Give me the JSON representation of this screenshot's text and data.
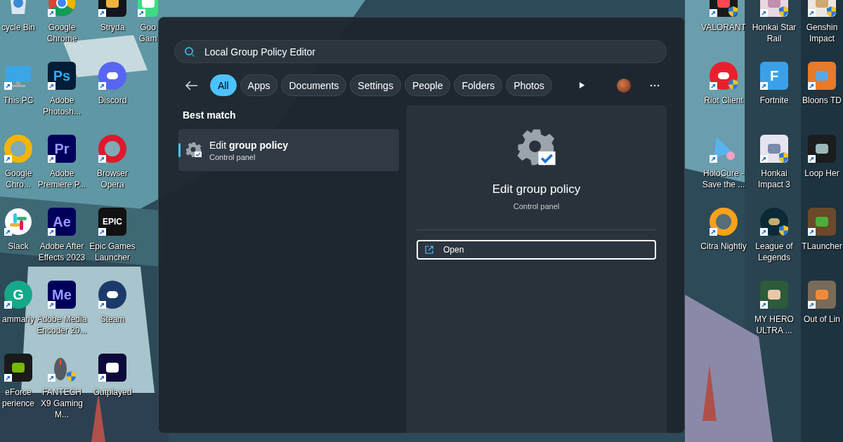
{
  "desktop": {
    "left_columns": [
      [
        {
          "label": "cycle Bin",
          "kind": "bin",
          "shortcut": false,
          "shield": false
        },
        {
          "label": "This PC",
          "kind": "monitor",
          "shortcut": true,
          "shield": false
        },
        {
          "label": "Google Chro...",
          "kind": "canary",
          "shortcut": true,
          "shield": false
        },
        {
          "label": "Slack",
          "kind": "slack",
          "shortcut": true,
          "shield": false
        },
        {
          "label": "ammarly",
          "kind": "grammarly",
          "glyph": "G",
          "shortcut": true,
          "shield": false
        },
        {
          "label": "eForce perience",
          "kind": "nvidia",
          "shortcut": true,
          "shield": false
        }
      ],
      [
        {
          "label": "Google Chrome",
          "kind": "chrome",
          "shortcut": true,
          "shield": false
        },
        {
          "label": "Adobe Photosh...",
          "kind": "photoshop",
          "glyph": "Ps",
          "shortcut": true,
          "shield": false
        },
        {
          "label": "Adobe Premiere P...",
          "kind": "adobe",
          "glyph": "Pr",
          "shortcut": true,
          "shield": false
        },
        {
          "label": "Adobe After Effects 2023",
          "kind": "adobe",
          "glyph": "Ae",
          "shortcut": true,
          "shield": false
        },
        {
          "label": "Adobe Media Encoder 20...",
          "kind": "adobe",
          "glyph": "Me",
          "shortcut": true,
          "shield": false
        },
        {
          "label": "FANTECH X9 Gaming M...",
          "kind": "mouse",
          "shortcut": true,
          "shield": true
        }
      ],
      [
        {
          "label": "Stryda",
          "kind": "stryda",
          "shortcut": true,
          "shield": false
        },
        {
          "label": "Discord",
          "kind": "discord",
          "shortcut": true,
          "shield": false
        },
        {
          "label": "Browser Opera",
          "kind": "opera",
          "shortcut": true,
          "shield": false
        },
        {
          "label": "Epic Games Launcher",
          "kind": "epic",
          "glyph": "EPIC",
          "shortcut": true,
          "shield": false
        },
        {
          "label": "Steam",
          "kind": "steam",
          "shortcut": true,
          "shield": false
        },
        {
          "label": "Outplayed",
          "kind": "outplayed",
          "shortcut": true,
          "shield": false
        }
      ],
      [
        {
          "label": "Goo Gam",
          "kind": "games",
          "shortcut": true,
          "shield": false
        }
      ]
    ],
    "right_columns": [
      [
        {
          "label": "VALORANT",
          "kind": "valorant",
          "shortcut": true,
          "shield": true
        },
        {
          "label": "Riot Client",
          "kind": "riot",
          "shortcut": true,
          "shield": true
        },
        {
          "label": "HoloCure - Save the ...",
          "kind": "cone",
          "shortcut": true,
          "shield": false
        },
        {
          "label": "Citra Nightly",
          "kind": "citra",
          "shortcut": true,
          "shield": false
        }
      ],
      [
        {
          "label": "Honkai Star Rail",
          "kind": "hsr",
          "shortcut": true,
          "shield": true
        },
        {
          "label": "Fortnite",
          "kind": "fortnite",
          "glyph": "F",
          "shortcut": true,
          "shield": false
        },
        {
          "label": "Honkai Impact 3",
          "kind": "honkai",
          "shortcut": true,
          "shield": true
        },
        {
          "label": "League of Legends",
          "kind": "league",
          "shortcut": true,
          "shield": true
        },
        {
          "label": "MY HERO ULTRA ...",
          "kind": "myhero",
          "shortcut": true,
          "shield": false
        }
      ],
      [
        {
          "label": "Genshin Impact",
          "kind": "genshin",
          "shortcut": true,
          "shield": true
        },
        {
          "label": "Bloons TD",
          "kind": "bloons",
          "shortcut": true,
          "shield": false
        },
        {
          "label": "Loop Her",
          "kind": "loophero",
          "shortcut": true,
          "shield": false
        },
        {
          "label": "TLauncher",
          "kind": "tlauncher",
          "shortcut": true,
          "shield": false
        },
        {
          "label": "Out of Lin",
          "kind": "outofline",
          "shortcut": true,
          "shield": false
        }
      ]
    ]
  },
  "search": {
    "value": "Local Group Policy Editor"
  },
  "filters": [
    {
      "label": "All",
      "selected": true
    },
    {
      "label": "Apps",
      "selected": false
    },
    {
      "label": "Documents",
      "selected": false
    },
    {
      "label": "Settings",
      "selected": false
    },
    {
      "label": "People",
      "selected": false
    },
    {
      "label": "Folders",
      "selected": false
    },
    {
      "label": "Photos",
      "selected": false
    }
  ],
  "results": {
    "heading": "Best match",
    "items": [
      {
        "title": "Edit **group policy**",
        "subtitle": "Control panel",
        "selected": true
      }
    ]
  },
  "preview": {
    "title": "Edit group policy",
    "subtitle": "Control panel",
    "actions": [
      "Open"
    ]
  }
}
